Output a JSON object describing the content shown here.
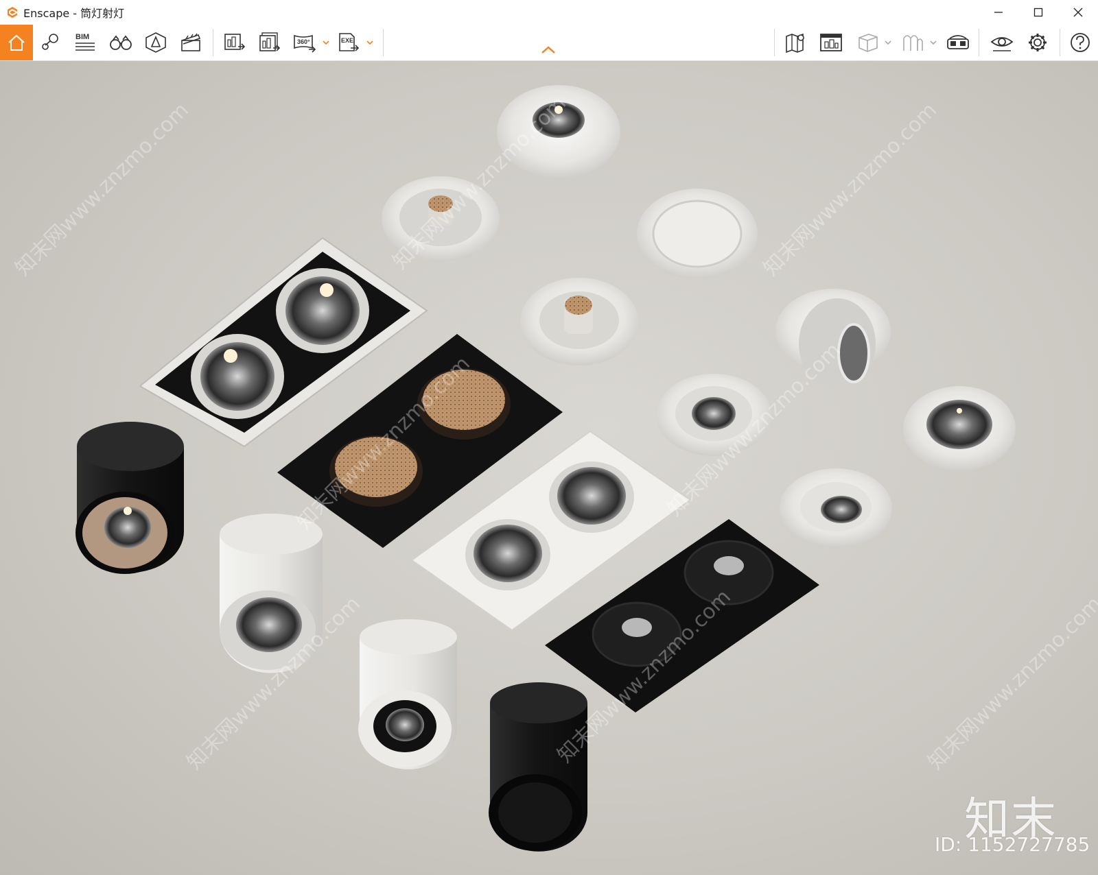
{
  "window": {
    "app_title": "Enscape - 筒灯射灯",
    "brand_color": "#f58220",
    "controls": {
      "minimize_icon": "minimize-icon",
      "maximize_icon": "maximize-icon",
      "close_icon": "close-icon"
    }
  },
  "toolbar": {
    "left_buttons": [
      {
        "name": "home",
        "icon": "home-icon",
        "active": true
      },
      {
        "name": "views-and-places",
        "icon": "location-pin-icon"
      },
      {
        "name": "bim",
        "icon": "bim-icon",
        "label": "BIM"
      },
      {
        "name": "walk-mode",
        "icon": "binoculars-icon"
      },
      {
        "name": "asset-library",
        "icon": "asset-library-icon"
      },
      {
        "name": "video-editor",
        "icon": "clapperboard-icon"
      },
      {
        "name": "render-image",
        "icon": "render-image-icon"
      },
      {
        "name": "batch-render",
        "icon": "batch-render-icon"
      },
      {
        "name": "export-360",
        "icon": "panorama-360-icon",
        "label": "360°"
      },
      {
        "name": "export-exe",
        "icon": "export-exe-icon",
        "label": "EXE"
      }
    ],
    "right_buttons": [
      {
        "name": "site-context",
        "icon": "map-icon"
      },
      {
        "name": "screenshots-gallery",
        "icon": "gallery-icon"
      },
      {
        "name": "material-editor",
        "icon": "cube-icon"
      },
      {
        "name": "atmosphere",
        "icon": "atmosphere-icon"
      },
      {
        "name": "vr-headset",
        "icon": "vr-headset-icon"
      },
      {
        "name": "visual-settings",
        "icon": "eye-icon"
      },
      {
        "name": "general-settings",
        "icon": "gear-icon"
      },
      {
        "name": "help",
        "icon": "help-icon"
      }
    ],
    "collapse_icon": "chevron-up-icon"
  },
  "viewport": {
    "watermark_brand": "知末",
    "watermark_id": "ID: 1152727785",
    "watermark_repeat": "知末网www.znzmo.com"
  }
}
